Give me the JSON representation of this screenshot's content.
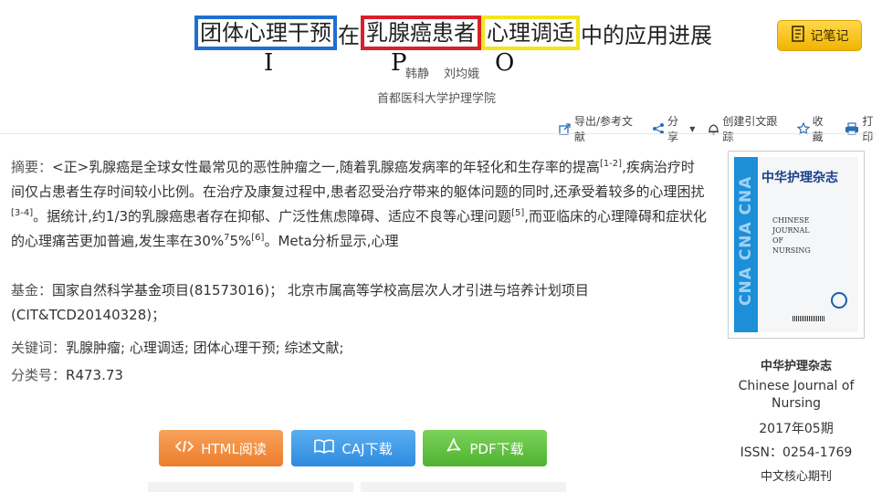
{
  "title": {
    "part1": "团体心理干预",
    "part2": "在",
    "part3": "乳腺癌患者",
    "part4": "心理调适",
    "part5": "中的应用进展"
  },
  "annotation_letters": {
    "i": "I",
    "p": "P",
    "o": "O"
  },
  "authors": {
    "author1": "韩静",
    "author2": "刘均娥"
  },
  "affiliation": "首都医科大学护理学院",
  "toolbar": {
    "export": "导出/参考文献",
    "share": "分享",
    "tracking": "创建引文跟踪",
    "collect": "收藏",
    "print": "打印"
  },
  "note_button": "记笔记",
  "abstract": {
    "label": "摘要：",
    "t1": "<正>乳腺癌是全球女性最常见的恶性肿瘤之一,随着乳腺癌发病率的年轻化和生存率的提高",
    "s1": "[1-2]",
    "t2": ",疾病治疗时间仅占患者生存时间较小比例。在治疗及康复过程中,患者忍受治疗带来的躯体问题的同时,还承受着较多的心理困扰",
    "s2": "[3-4]",
    "t3": "。据统计,约1/3的乳腺癌患者存在抑郁、广泛性焦虑障碍、适应不良等心理问题",
    "s3": "[5]",
    "t4": ",而亚临床的心理障碍和症状化的心理痛苦更加普遍,发生率在30%",
    "s4": "7",
    "t5": "5%",
    "s5": "[6]",
    "t6": "。Meta分析显示,心理"
  },
  "fund": {
    "label": "基金：",
    "value": "国家自然科学基金项目(81573016)；  北京市属高等学校高层次人才引进与培养计划项目(CIT&TCD20140328)；"
  },
  "keywords": {
    "label": "关键词：",
    "value": "乳腺肿瘤; 心理调适; 团体心理干预; 综述文献;"
  },
  "classification": {
    "label": "分类号：",
    "value": "R473.73"
  },
  "journal": {
    "cover_title": "中华护理杂志",
    "cover_en_1": "CHINESE",
    "cover_en_2": "JOURNAL",
    "cover_en_3": "OF",
    "cover_en_4": "NURSING",
    "cover_band": "CNA CNA CNA",
    "name_cn": "中华护理杂志",
    "name_en": "Chinese Journal of Nursing",
    "issue": "2017年05期",
    "issn": "ISSN：0254-1769",
    "core": "中文核心期刊"
  },
  "downloads": {
    "html": "HTML阅读",
    "caj": "CAJ下载",
    "pdf": "PDF下载"
  },
  "colors": {
    "highlight_blue": "#1f6fd1",
    "highlight_red": "#d8202a",
    "highlight_yellow": "#f3e51b",
    "note_button": "#f0b400",
    "html_button": "#ec7e2c",
    "caj_button": "#2d8be0",
    "pdf_button": "#4fb230"
  },
  "icons": [
    "notebook-icon",
    "export-icon",
    "share-icon",
    "bell-icon",
    "star-icon",
    "printer-icon",
    "code-icon",
    "book-icon",
    "pdf-icon"
  ]
}
